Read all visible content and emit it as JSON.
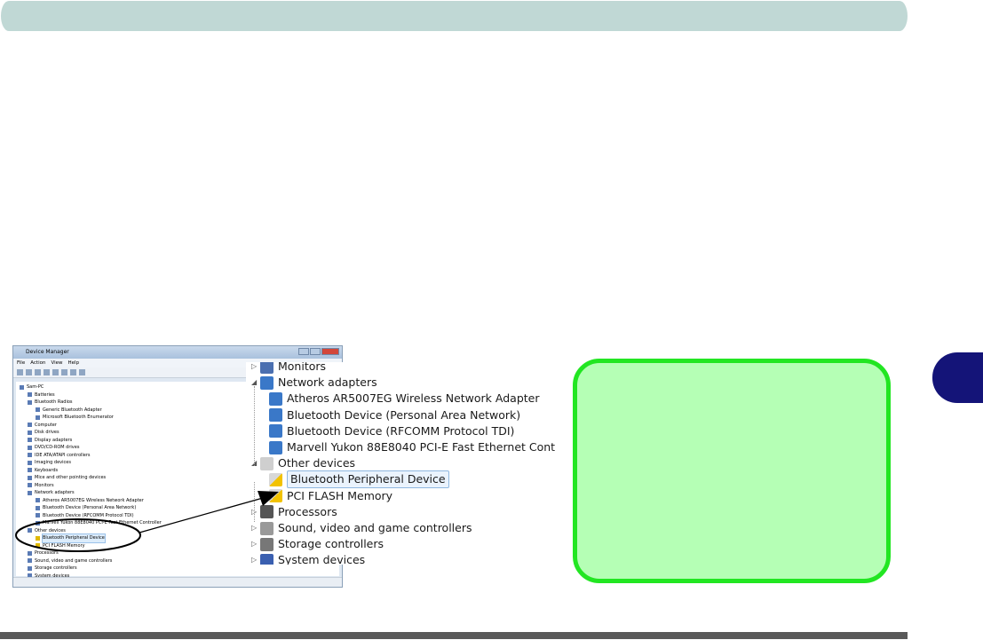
{
  "colors": {
    "header_bar": "#c0d8d5",
    "side_tab": "#141478",
    "footer_bar": "#595959",
    "note_border": "#22e622",
    "note_fill": "#b5ffb5"
  },
  "device_manager": {
    "title": "Device Manager",
    "menu": [
      "File",
      "Action",
      "View",
      "Help"
    ],
    "tree": [
      {
        "label": "Sam-PC",
        "level": 0
      },
      {
        "label": "Batteries",
        "level": 1
      },
      {
        "label": "Bluetooth Radios",
        "level": 1
      },
      {
        "label": "Generic Bluetooth Adapter",
        "level": 2
      },
      {
        "label": "Microsoft Bluetooth Enumerator",
        "level": 2
      },
      {
        "label": "Computer",
        "level": 1
      },
      {
        "label": "Disk drives",
        "level": 1
      },
      {
        "label": "Display adapters",
        "level": 1
      },
      {
        "label": "DVD/CD-ROM drives",
        "level": 1
      },
      {
        "label": "IDE ATA/ATAPI controllers",
        "level": 1
      },
      {
        "label": "Imaging devices",
        "level": 1
      },
      {
        "label": "Keyboards",
        "level": 1
      },
      {
        "label": "Mice and other pointing devices",
        "level": 1
      },
      {
        "label": "Monitors",
        "level": 1
      },
      {
        "label": "Network adapters",
        "level": 1
      },
      {
        "label": "Atheros AR5007EG Wireless Network Adapter",
        "level": 2
      },
      {
        "label": "Bluetooth Device (Personal Area Network)",
        "level": 2
      },
      {
        "label": "Bluetooth Device (RFCOMM Protocol TDI)",
        "level": 2
      },
      {
        "label": "Marvell Yukon 88E8040 PCI-E Fast Ethernet Controller",
        "level": 2
      },
      {
        "label": "Other devices",
        "level": 1
      },
      {
        "label": "Bluetooth Peripheral Device",
        "level": 2,
        "selected": true
      },
      {
        "label": "PCI FLASH Memory",
        "level": 2
      },
      {
        "label": "Processors",
        "level": 1
      },
      {
        "label": "Sound, video and game controllers",
        "level": 1
      },
      {
        "label": "Storage controllers",
        "level": 1
      },
      {
        "label": "System devices",
        "level": 1
      }
    ]
  },
  "zoomed_view": [
    {
      "label": "Monitors",
      "level": 0,
      "icon": "monitor-icon",
      "expander": "collapsed"
    },
    {
      "label": "Network adapters",
      "level": 0,
      "icon": "network-icon",
      "expander": "expanded"
    },
    {
      "label": "Atheros AR5007EG Wireless Network Adapter",
      "level": 1,
      "icon": "network-icon"
    },
    {
      "label": "Bluetooth Device (Personal Area Network)",
      "level": 1,
      "icon": "network-icon"
    },
    {
      "label": "Bluetooth Device (RFCOMM Protocol TDI)",
      "level": 1,
      "icon": "network-icon"
    },
    {
      "label": "Marvell Yukon 88E8040 PCI-E Fast Ethernet Controller",
      "level": 1,
      "icon": "network-icon"
    },
    {
      "label": "Other devices",
      "level": 0,
      "icon": "unknown-device-icon",
      "expander": "expanded"
    },
    {
      "label": "Bluetooth Peripheral Device",
      "level": 1,
      "icon": "warning-device-icon",
      "selected": true
    },
    {
      "label": "PCI FLASH Memory",
      "level": 1,
      "icon": "warning-device-icon"
    },
    {
      "label": "Processors",
      "level": 0,
      "icon": "processor-icon",
      "expander": "collapsed"
    },
    {
      "label": "Sound, video and game controllers",
      "level": 0,
      "icon": "speaker-icon",
      "expander": "collapsed"
    },
    {
      "label": "Storage controllers",
      "level": 0,
      "icon": "storage-icon",
      "expander": "collapsed"
    },
    {
      "label": "System devices",
      "level": 0,
      "icon": "system-icon",
      "expander": "collapsed"
    }
  ]
}
